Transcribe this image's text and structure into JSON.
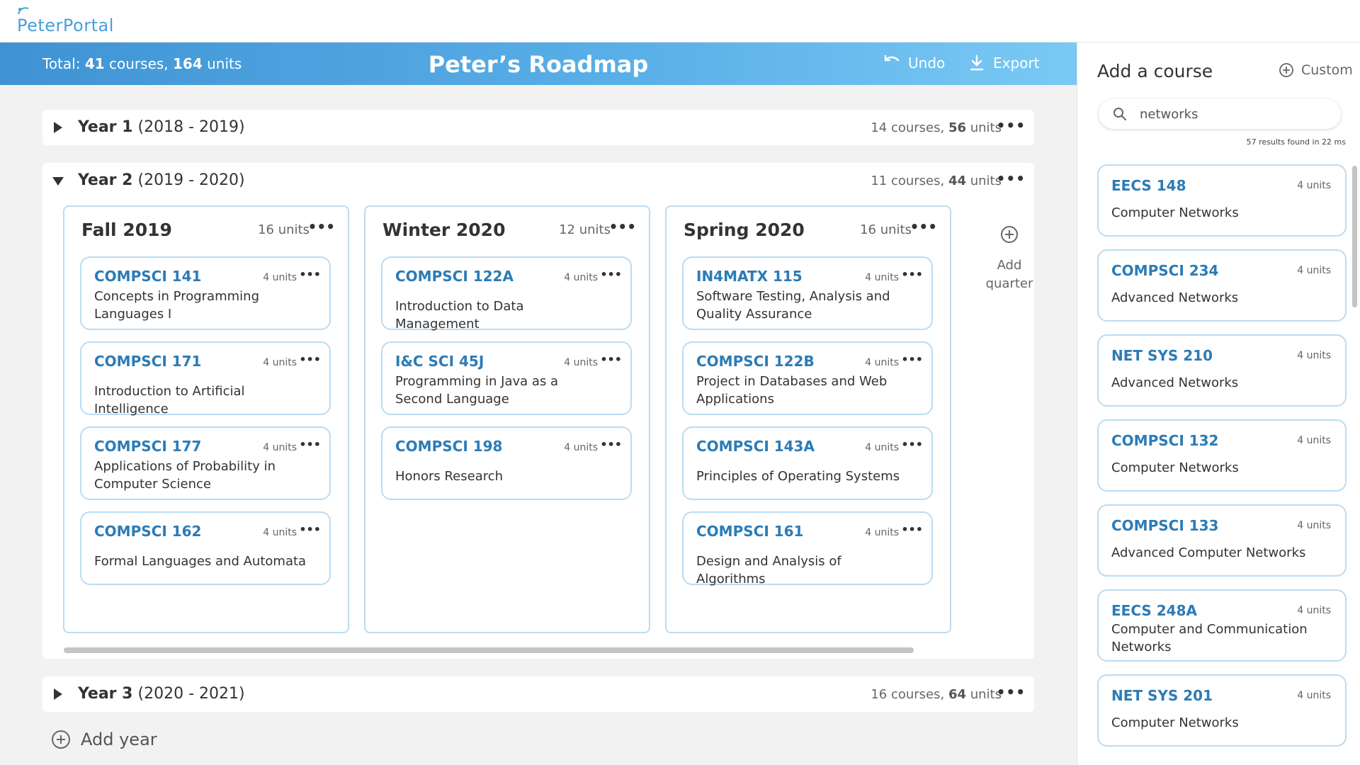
{
  "app": {
    "logo_text": "PeterPortal"
  },
  "header": {
    "total_prefix": "Total: ",
    "total_courses": "41",
    "courses_word": " courses, ",
    "total_units": "164",
    "units_word": " units",
    "title": "Peter’s Roadmap",
    "undo_label": "Undo",
    "export_label": "Export"
  },
  "years": [
    {
      "label": "Year 1",
      "range": "(2018 - 2019)",
      "courses": "14",
      "units": "56",
      "expanded": false
    },
    {
      "label": "Year 2",
      "range": "(2019 - 2020)",
      "courses": "11",
      "units": "44",
      "expanded": true
    },
    {
      "label": "Year 3",
      "range": "(2020 - 2021)",
      "courses": "16",
      "units": "64",
      "expanded": false
    }
  ],
  "stats_words": {
    "courses": " courses, ",
    "units": " units"
  },
  "quarters": [
    {
      "title": "Fall 2019",
      "units": "16 units",
      "courses": [
        {
          "code": "COMPSCI 141",
          "units": "4 units",
          "name": "Concepts in Programming Languages I"
        },
        {
          "code": "COMPSCI 171",
          "units": "4 units",
          "name": "Introduction to Artificial Intelligence"
        },
        {
          "code": "COMPSCI 177",
          "units": "4 units",
          "name": "Applications of Probability in Computer Science"
        },
        {
          "code": "COMPSCI 162",
          "units": "4 units",
          "name": "Formal Languages and Automata"
        }
      ]
    },
    {
      "title": "Winter 2020",
      "units": "12 units",
      "courses": [
        {
          "code": "COMPSCI 122A",
          "units": "4 units",
          "name": "Introduction to Data Management"
        },
        {
          "code": "I&C SCI 45J",
          "units": "4 units",
          "name": "Programming in Java as a Second Language"
        },
        {
          "code": "COMPSCI 198",
          "units": "4 units",
          "name": "Honors Research"
        }
      ]
    },
    {
      "title": "Spring 2020",
      "units": "16 units",
      "courses": [
        {
          "code": "IN4MATX 115",
          "units": "4 units",
          "name": "Software Testing, Analysis and Quality Assurance"
        },
        {
          "code": "COMPSCI 122B",
          "units": "4 units",
          "name": "Project in Databases and Web Applications"
        },
        {
          "code": "COMPSCI 143A",
          "units": "4 units",
          "name": "Principles of Operating Systems"
        },
        {
          "code": "COMPSCI 161",
          "units": "4 units",
          "name": "Design and Analysis of Algorithms"
        }
      ]
    }
  ],
  "add_quarter": {
    "line1": "Add",
    "line2": "quarter"
  },
  "add_year_label": "Add year",
  "sidebar": {
    "title": "Add a course",
    "custom_label": "Custom",
    "search_value": "networks",
    "results_text": "57 results found in 22 ms",
    "results": [
      {
        "code": "EECS 148",
        "units": "4 units",
        "name": "Computer Networks"
      },
      {
        "code": "COMPSCI 234",
        "units": "4 units",
        "name": "Advanced Networks"
      },
      {
        "code": "NET SYS 210",
        "units": "4 units",
        "name": "Advanced Networks"
      },
      {
        "code": "COMPSCI 132",
        "units": "4 units",
        "name": "Computer Networks"
      },
      {
        "code": "COMPSCI 133",
        "units": "4 units",
        "name": "Advanced Computer Networks"
      },
      {
        "code": "EECS 248A",
        "units": "4 units",
        "name": "Computer and Communication Networks"
      },
      {
        "code": "NET SYS 201",
        "units": "4 units",
        "name": "Computer Networks"
      }
    ]
  },
  "colors": {
    "accent": "#2c7bb6",
    "header_start": "#3f93d4",
    "header_end": "#7ac9f5",
    "card_border": "#bcdcf2"
  },
  "icons": {
    "undo": "undo-icon",
    "export": "download-icon",
    "plus": "plus-circle-icon",
    "search": "search-icon",
    "more": "ellipsis-icon"
  }
}
